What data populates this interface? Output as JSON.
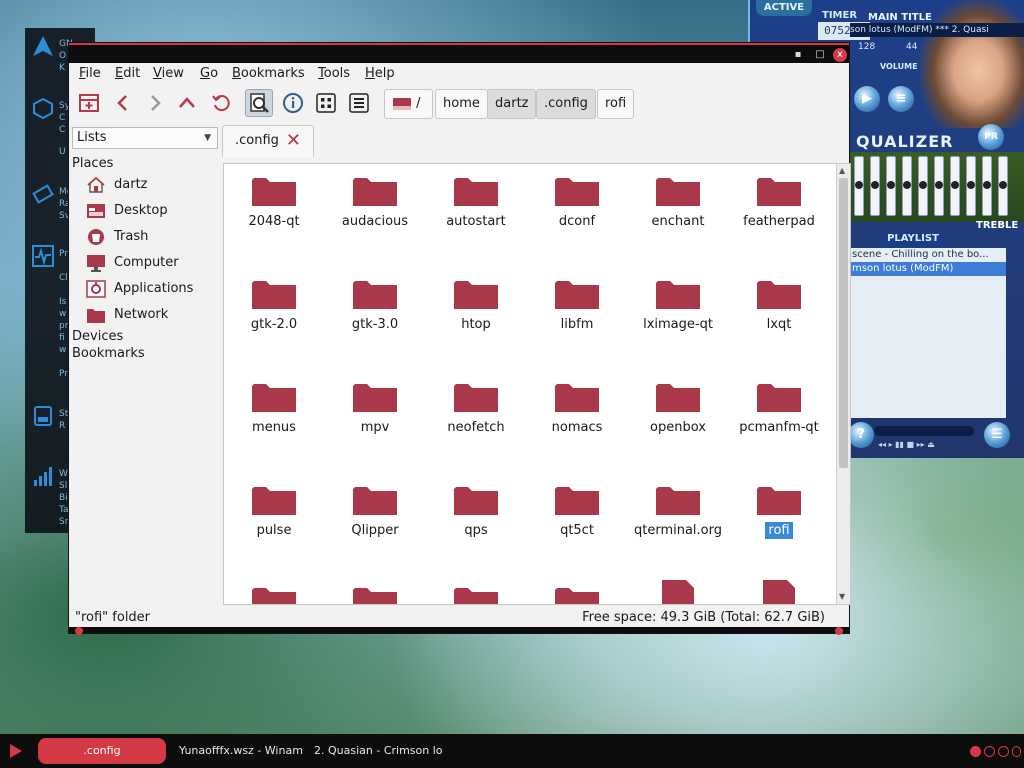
{
  "side_panel": {
    "lines": [
      "GN",
      "O",
      "K",
      "Sy",
      "C",
      "C",
      "U",
      "Me",
      "Ra",
      "Sv",
      "Pr",
      "Cl",
      "Is",
      "w",
      "pr",
      "fi",
      "w",
      "Pr",
      "St",
      "R",
      "Wi",
      "Sl",
      "Bi",
      "Ta",
      "Sr"
    ]
  },
  "winamp": {
    "active_label": "ACTIVE",
    "timer_label": "TIMER",
    "main_title_label": "MAIN TITLE",
    "timer_value": "0752 7",
    "title_text": "son lotus (ModFM) *** 2. Quasi",
    "kbps": "128",
    "khz": "44",
    "volume_label": "VOLUME",
    "eq_title": "QUALIZER",
    "pr_label": "PR",
    "treble_label": "TREBLE",
    "playlist_label": "PLAYLIST",
    "playlist_items": [
      {
        "text": "scene - Chilling on the bo...",
        "selected": false
      },
      {
        "text": "mson lotus (ModFM)",
        "selected": true
      }
    ],
    "help_btn": "?"
  },
  "window": {
    "titlebar": {
      "close": "x",
      "maximize": "□",
      "minimize": "▪"
    },
    "menu": [
      {
        "label": "File",
        "u": "F",
        "rest": "ile"
      },
      {
        "label": "Edit",
        "u": "E",
        "rest": "dit"
      },
      {
        "label": "View",
        "u": "V",
        "rest": "iew"
      },
      {
        "label": "Go",
        "u": "G",
        "rest": "o"
      },
      {
        "label": "Bookmarks",
        "u": "B",
        "rest": "ookmarks"
      },
      {
        "label": "Tools",
        "u": "T",
        "rest": "ools"
      },
      {
        "label": "Help",
        "u": "H",
        "rest": "elp"
      }
    ],
    "path_root": "/",
    "breadcrumbs": [
      "home",
      "dartz",
      ".config",
      "rofi"
    ],
    "sidebar": {
      "mode": "Lists",
      "places_header": "Places",
      "places": [
        {
          "label": "dartz",
          "icon": "home-icon"
        },
        {
          "label": "Desktop",
          "icon": "desktop-icon"
        },
        {
          "label": "Trash",
          "icon": "trash-icon"
        },
        {
          "label": "Computer",
          "icon": "computer-icon"
        },
        {
          "label": "Applications",
          "icon": "applications-icon"
        },
        {
          "label": "Network",
          "icon": "network-icon"
        }
      ],
      "devices_header": "Devices",
      "bookmarks_header": "Bookmarks"
    },
    "tab": {
      "label": ".config"
    },
    "folders": [
      "2048-qt",
      "audacious",
      "autostart",
      "dconf",
      "enchant",
      "featherpad",
      "gtk-2.0",
      "gtk-3.0",
      "htop",
      "libfm",
      "lximage-qt",
      "lxqt",
      "menus",
      "mpv",
      "neofetch",
      "nomacs",
      "openbox",
      "pcmanfm-qt",
      "pulse",
      "Qlipper",
      "qps",
      "qt5ct",
      "qterminal.org",
      "rofi"
    ],
    "selected_folder": "rofi",
    "status_left": "\"rofi\" folder",
    "status_right": "Free space: 49.3 GiB (Total: 62.7 GiB)",
    "folder_color": "#a8384a"
  },
  "taskbar": {
    "items": [
      {
        "label": ".config",
        "active": true
      },
      {
        "label": "Yunaofffx.wsz - Winam",
        "active": false
      },
      {
        "label": "2. Quasian - Crimson lo",
        "active": false
      }
    ],
    "accent": "#d33a45"
  }
}
